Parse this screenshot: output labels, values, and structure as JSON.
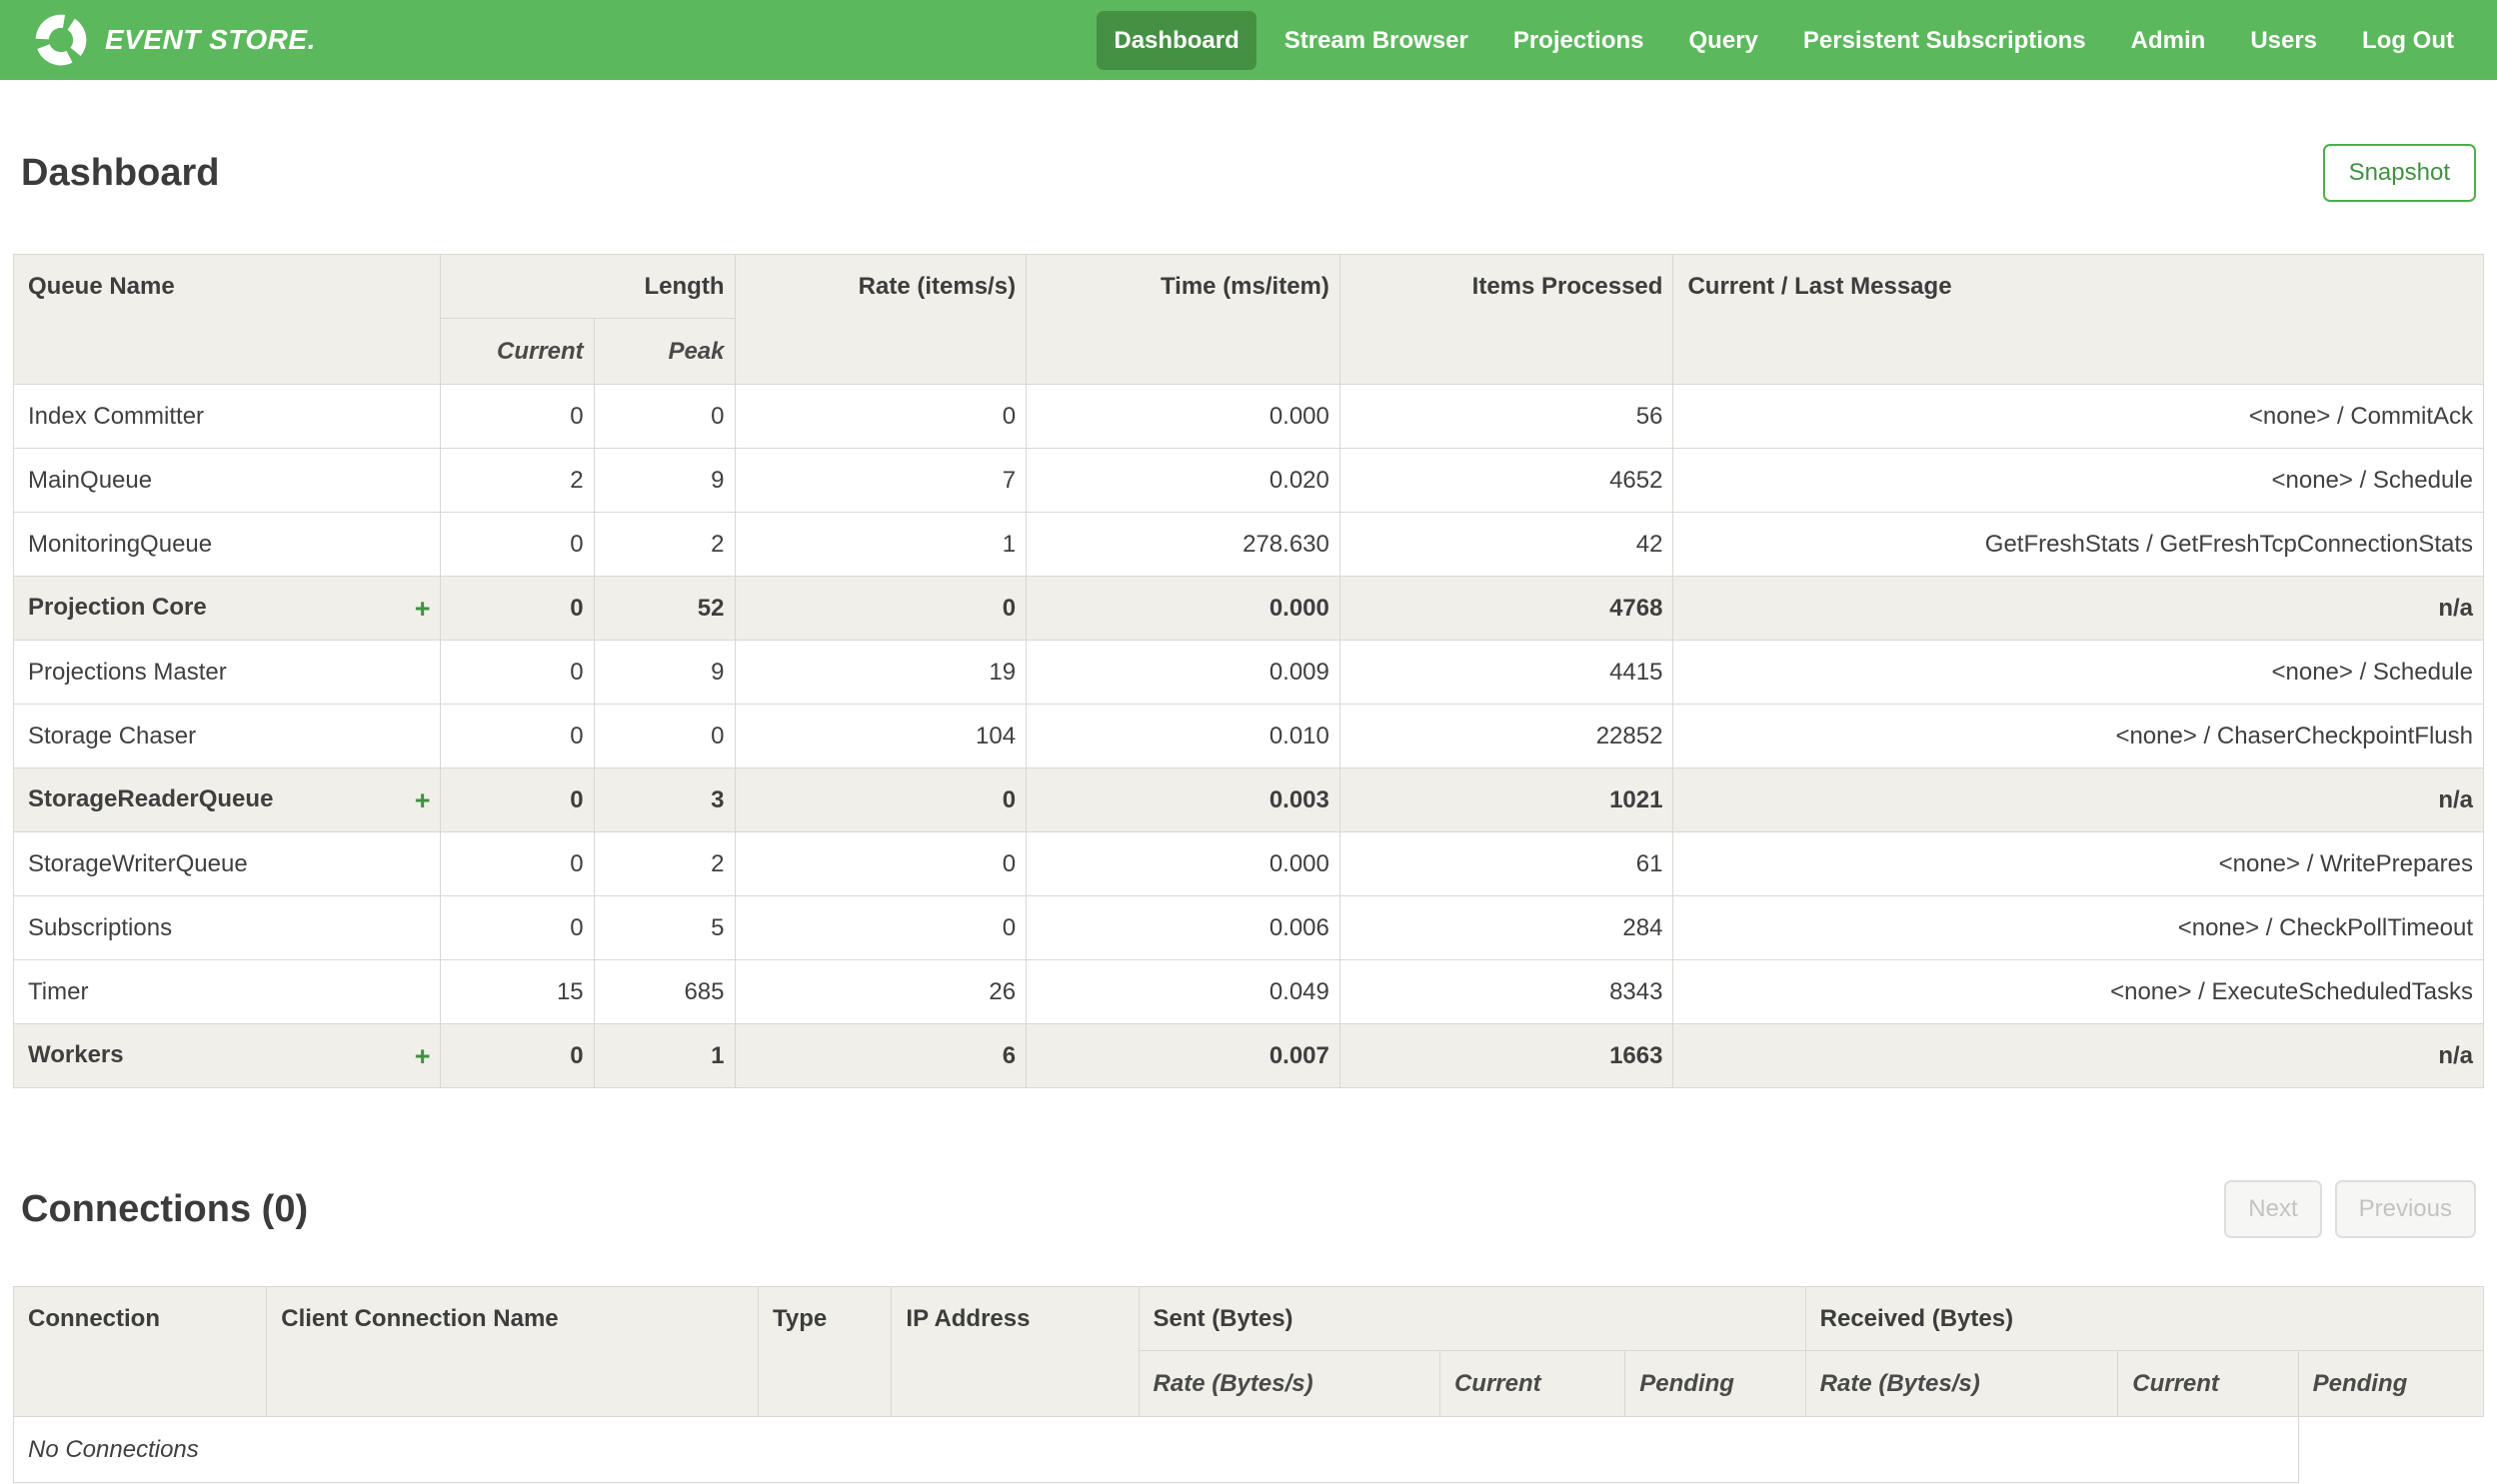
{
  "nav": {
    "brand": "EVENT STORE.",
    "items": [
      {
        "label": "Dashboard",
        "active": true
      },
      {
        "label": "Stream Browser",
        "active": false
      },
      {
        "label": "Projections",
        "active": false
      },
      {
        "label": "Query",
        "active": false
      },
      {
        "label": "Persistent Subscriptions",
        "active": false
      },
      {
        "label": "Admin",
        "active": false
      },
      {
        "label": "Users",
        "active": false
      },
      {
        "label": "Log Out",
        "active": false
      }
    ]
  },
  "page": {
    "title": "Dashboard",
    "snapshot_button": "Snapshot"
  },
  "colors": {
    "navbar_green": "#5cb85c",
    "active_item_green": "#449143",
    "accent_green": "#3f923f",
    "header_bg": "#f0efe9",
    "border": "#d8d8d2"
  },
  "queues_table": {
    "expand_icon": "+",
    "headers": {
      "queue_name": "Queue Name",
      "length": "Length",
      "current": "Current",
      "peak": "Peak",
      "rate": "Rate (items/s)",
      "time": "Time (ms/item)",
      "items_processed": "Items Processed",
      "message": "Current / Last Message"
    },
    "rows": [
      {
        "name": "Index Committer",
        "group": false,
        "current": "0",
        "peak": "0",
        "rate": "0",
        "time": "0.000",
        "items": "56",
        "message": "<none> / CommitAck"
      },
      {
        "name": "MainQueue",
        "group": false,
        "current": "2",
        "peak": "9",
        "rate": "7",
        "time": "0.020",
        "items": "4652",
        "message": "<none> / Schedule"
      },
      {
        "name": "MonitoringQueue",
        "group": false,
        "current": "0",
        "peak": "2",
        "rate": "1",
        "time": "278.630",
        "items": "42",
        "message": "GetFreshStats / GetFreshTcpConnectionStats"
      },
      {
        "name": "Projection Core",
        "group": true,
        "current": "0",
        "peak": "52",
        "rate": "0",
        "time": "0.000",
        "items": "4768",
        "message": "n/a"
      },
      {
        "name": "Projections Master",
        "group": false,
        "current": "0",
        "peak": "9",
        "rate": "19",
        "time": "0.009",
        "items": "4415",
        "message": "<none> / Schedule"
      },
      {
        "name": "Storage Chaser",
        "group": false,
        "current": "0",
        "peak": "0",
        "rate": "104",
        "time": "0.010",
        "items": "22852",
        "message": "<none> / ChaserCheckpointFlush"
      },
      {
        "name": "StorageReaderQueue",
        "group": true,
        "current": "0",
        "peak": "3",
        "rate": "0",
        "time": "0.003",
        "items": "1021",
        "message": "n/a"
      },
      {
        "name": "StorageWriterQueue",
        "group": false,
        "current": "0",
        "peak": "2",
        "rate": "0",
        "time": "0.000",
        "items": "61",
        "message": "<none> / WritePrepares"
      },
      {
        "name": "Subscriptions",
        "group": false,
        "current": "0",
        "peak": "5",
        "rate": "0",
        "time": "0.006",
        "items": "284",
        "message": "<none> / CheckPollTimeout"
      },
      {
        "name": "Timer",
        "group": false,
        "current": "15",
        "peak": "685",
        "rate": "26",
        "time": "0.049",
        "items": "8343",
        "message": "<none> / ExecuteScheduledTasks"
      },
      {
        "name": "Workers",
        "group": true,
        "current": "0",
        "peak": "1",
        "rate": "6",
        "time": "0.007",
        "items": "1663",
        "message": "n/a"
      }
    ]
  },
  "connections": {
    "title": "Connections (0)",
    "pager": {
      "next": "Next",
      "previous": "Previous"
    },
    "headers": {
      "connection": "Connection",
      "client_name": "Client Connection Name",
      "type": "Type",
      "ip": "IP Address",
      "sent": "Sent (Bytes)",
      "received": "Received (Bytes)",
      "rate": "Rate (Bytes/s)",
      "current": "Current",
      "pending": "Pending"
    },
    "empty_message": "No Connections"
  }
}
